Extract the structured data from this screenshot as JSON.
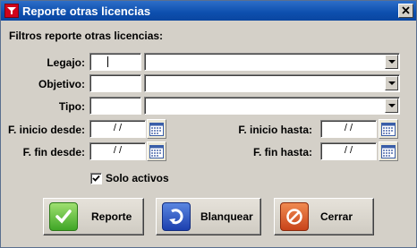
{
  "window": {
    "title": "Reporte otras licencias"
  },
  "section_title": "Filtros reporte otras licencias:",
  "fields": {
    "legajo": {
      "label": "Legajo:",
      "code": "",
      "value": ""
    },
    "objetivo": {
      "label": "Objetivo:",
      "code": "",
      "value": ""
    },
    "tipo": {
      "label": "Tipo:",
      "code": "",
      "value": ""
    }
  },
  "dates": {
    "inicio_desde": {
      "label": "F. inicio desde:",
      "value": " / /"
    },
    "inicio_hasta": {
      "label": "F. inicio hasta:",
      "value": " / /"
    },
    "fin_desde": {
      "label": "F. fin desde:",
      "value": " / /"
    },
    "fin_hasta": {
      "label": "F. fin hasta:",
      "value": " / /"
    }
  },
  "solo_activos": {
    "label": "Solo activos",
    "checked": true
  },
  "buttons": {
    "reporte": "Reporte",
    "blanquear": "Blanquear",
    "cerrar": "Cerrar"
  },
  "icons": {
    "app": "filter-funnel-icon",
    "close": "close-icon",
    "calendar": "calendar-icon",
    "reporte": "checkmark-icon",
    "blanquear": "refresh-arrow-icon",
    "cerrar": "cancel-circle-icon"
  },
  "colors": {
    "titlebar": "#0d4fae",
    "dialog_bg": "#d4d0c8",
    "app_icon": "#d0021b"
  }
}
